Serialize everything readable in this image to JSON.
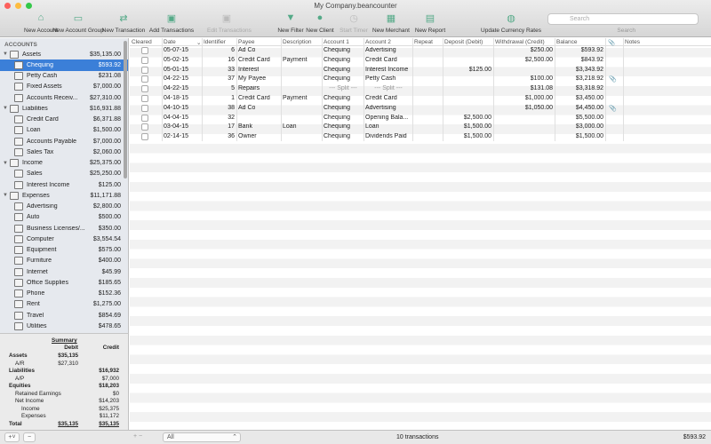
{
  "window": {
    "title": "My Company.beancounter"
  },
  "toolbar": [
    {
      "label": "New Account",
      "icon": "house-plus-icon",
      "disabled": false
    },
    {
      "label": "New Account Group",
      "icon": "folder-plus-icon",
      "disabled": false
    },
    {
      "label": "New Transaction",
      "icon": "arrows-plus-icon",
      "disabled": false
    },
    {
      "label": "Add Transactions",
      "icon": "transactions-plus-icon",
      "disabled": false
    },
    {
      "label": "Edit Transactions",
      "icon": "transactions-edit-icon",
      "disabled": true
    },
    {
      "label": "New Filter",
      "icon": "funnel-plus-icon",
      "disabled": false
    },
    {
      "label": "New Client",
      "icon": "person-icon",
      "disabled": false
    },
    {
      "label": "Start Timer",
      "icon": "timer-icon",
      "disabled": true
    },
    {
      "label": "New Merchant",
      "icon": "store-icon",
      "disabled": false
    },
    {
      "label": "New Report",
      "icon": "report-icon",
      "disabled": false
    },
    {
      "label": "Update Currency Rates",
      "icon": "globe-refresh-icon",
      "disabled": false
    }
  ],
  "search": {
    "placeholder": "Search",
    "label": "Search"
  },
  "sidebar": {
    "header": "ACCOUNTS",
    "items": [
      {
        "name": "Assets",
        "amount": "$35,135.00",
        "group": true
      },
      {
        "name": "Chequing",
        "amount": "$593.92",
        "selected": true
      },
      {
        "name": "Petty Cash",
        "amount": "$231.08"
      },
      {
        "name": "Fixed Assets",
        "amount": "$7,000.00"
      },
      {
        "name": "Accounts Receiv...",
        "amount": "$27,310.00"
      },
      {
        "name": "Liabilities",
        "amount": "$16,931.88",
        "group": true
      },
      {
        "name": "Credit Card",
        "amount": "$6,371.88"
      },
      {
        "name": "Loan",
        "amount": "$1,500.00"
      },
      {
        "name": "Accounts Payable",
        "amount": "$7,000.00"
      },
      {
        "name": "Sales Tax",
        "amount": "$2,060.00"
      },
      {
        "name": "Income",
        "amount": "$25,375.00",
        "group": true
      },
      {
        "name": "Sales",
        "amount": "$25,250.00"
      },
      {
        "name": "Interest Income",
        "amount": "$125.00"
      },
      {
        "name": "Expenses",
        "amount": "$11,171.88",
        "group": true
      },
      {
        "name": "Advertising",
        "amount": "$2,800.00"
      },
      {
        "name": "Auto",
        "amount": "$500.00"
      },
      {
        "name": "Business Licenses/...",
        "amount": "$350.00"
      },
      {
        "name": "Computer",
        "amount": "$3,554.54"
      },
      {
        "name": "Equipment",
        "amount": "$575.00"
      },
      {
        "name": "Furniture",
        "amount": "$400.00"
      },
      {
        "name": "Internet",
        "amount": "$45.99"
      },
      {
        "name": "Office Supplies",
        "amount": "$185.65"
      },
      {
        "name": "Phone",
        "amount": "$152.36"
      },
      {
        "name": "Rent",
        "amount": "$1,275.00"
      },
      {
        "name": "Travel",
        "amount": "$854.69"
      },
      {
        "name": "Utilities",
        "amount": "$478.65"
      }
    ]
  },
  "summary": {
    "title": "Summary",
    "debit_label": "Debit",
    "credit_label": "Credit",
    "rows": [
      {
        "label": "Assets",
        "debit": "$35,135",
        "credit": "",
        "bold": true,
        "indent": 0
      },
      {
        "label": "A/R",
        "debit": "$27,310",
        "credit": "",
        "indent": 1
      },
      {
        "label": "Liabilities",
        "debit": "",
        "credit": "$16,932",
        "bold": true,
        "indent": 0
      },
      {
        "label": "A/P",
        "debit": "",
        "credit": "$7,000",
        "indent": 1
      },
      {
        "label": "Equities",
        "debit": "",
        "credit": "$18,203",
        "bold": true,
        "indent": 0
      },
      {
        "label": "Retained Earnings",
        "debit": "",
        "credit": "$0",
        "indent": 1
      },
      {
        "label": "Net Income",
        "debit": "",
        "credit": "$14,203",
        "indent": 1
      },
      {
        "label": "Income",
        "debit": "",
        "credit": "$25,375",
        "indent": 2
      },
      {
        "label": "Expenses",
        "debit": "",
        "credit": "$11,172",
        "indent": 2
      },
      {
        "label": "Total",
        "debit": "$35,135",
        "credit": "$35,135",
        "bold": true,
        "indent": 0
      }
    ]
  },
  "table": {
    "columns": [
      "Cleared",
      "Date",
      "Identifier",
      "Payee",
      "Description",
      "Account 1",
      "Account 2",
      "Repeat",
      "Deposit (Debit)",
      "Withdrawal (Credit)",
      "Balance",
      "Notes"
    ],
    "rows": [
      {
        "date": "05-07-15",
        "id": "6",
        "payee": "Ad Co",
        "desc": "",
        "acc1": "Chequing",
        "acc2": "Advertising",
        "deposit": "",
        "withdrawal": "$250.00",
        "balance": "$593.92",
        "attach": false
      },
      {
        "date": "05-02-15",
        "id": "16",
        "payee": "Credit Card",
        "desc": "Payment",
        "acc1": "Chequing",
        "acc2": "Credit Card",
        "deposit": "",
        "withdrawal": "$2,500.00",
        "balance": "$843.92",
        "attach": false
      },
      {
        "date": "05-01-15",
        "id": "33",
        "payee": "Interest",
        "desc": "",
        "acc1": "Chequing",
        "acc2": "Interest Income",
        "deposit": "$125.00",
        "withdrawal": "",
        "balance": "$3,343.92",
        "attach": false
      },
      {
        "date": "04-22-15",
        "id": "37",
        "payee": "My Payee",
        "desc": "",
        "acc1": "Chequing",
        "acc2": "Petty Cash",
        "deposit": "",
        "withdrawal": "$100.00",
        "balance": "$3,218.92",
        "attach": true
      },
      {
        "date": "04-22-15",
        "id": "5",
        "payee": "Repairs",
        "desc": "",
        "acc1": "--- Split ---",
        "acc2": "--- Split ---",
        "deposit": "",
        "withdrawal": "$131.08",
        "balance": "$3,318.92",
        "attach": false,
        "split": true
      },
      {
        "date": "04-18-15",
        "id": "1",
        "payee": "Credit Card",
        "desc": "Payment",
        "acc1": "Chequing",
        "acc2": "Credit Card",
        "deposit": "",
        "withdrawal": "$1,000.00",
        "balance": "$3,450.00",
        "attach": false
      },
      {
        "date": "04-10-15",
        "id": "38",
        "payee": "Ad Co",
        "desc": "",
        "acc1": "Chequing",
        "acc2": "Advertising",
        "deposit": "",
        "withdrawal": "$1,050.00",
        "balance": "$4,450.00",
        "attach": true
      },
      {
        "date": "04-04-15",
        "id": "32",
        "payee": "",
        "desc": "",
        "acc1": "Chequing",
        "acc2": "Opening Bala...",
        "deposit": "$2,500.00",
        "withdrawal": "",
        "balance": "$5,500.00",
        "attach": false
      },
      {
        "date": "03-04-15",
        "id": "17",
        "payee": "Bank",
        "desc": "Loan",
        "acc1": "Chequing",
        "acc2": "Loan",
        "deposit": "$1,500.00",
        "withdrawal": "",
        "balance": "$3,000.00",
        "attach": false
      },
      {
        "date": "02-14-15",
        "id": "36",
        "payee": "Owner",
        "desc": "",
        "acc1": "Chequing",
        "acc2": "Dividends Paid",
        "deposit": "$1,500.00",
        "withdrawal": "",
        "balance": "$1,500.00",
        "attach": false
      }
    ]
  },
  "status": {
    "filter": "All",
    "count": "10 transactions",
    "balance": "$593.92",
    "add": "+",
    "remove": "−"
  },
  "colors": {
    "selection": "#3b7fd8",
    "close": "#fc605c",
    "minimize": "#fdbc40",
    "zoom": "#34c84a"
  }
}
